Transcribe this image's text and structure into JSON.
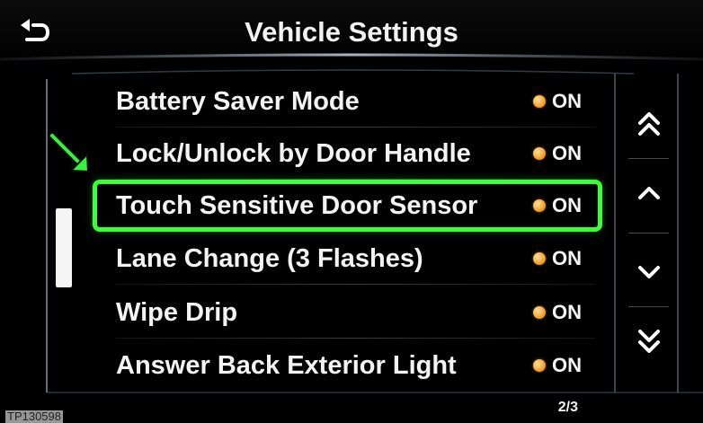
{
  "header": {
    "title": "Vehicle Settings",
    "back_icon": "back-icon"
  },
  "settings": [
    {
      "label": "Battery Saver Mode",
      "value": "ON",
      "status_color": "#f5a12b"
    },
    {
      "label": "Lock/Unlock by Door Handle",
      "value": "ON",
      "status_color": "#f5a12b"
    },
    {
      "label": "Touch Sensitive Door Sensor",
      "value": "ON",
      "status_color": "#f5a12b"
    },
    {
      "label": "Lane Change (3 Flashes)",
      "value": "ON",
      "status_color": "#f5a12b"
    },
    {
      "label": "Wipe Drip",
      "value": "ON",
      "status_color": "#f5a12b"
    },
    {
      "label": "Answer Back Exterior Light",
      "value": "ON",
      "status_color": "#f5a12b"
    }
  ],
  "navigation": {
    "page_up_icon": "double-chevron-up-icon",
    "line_up_icon": "chevron-up-icon",
    "line_down_icon": "chevron-down-icon",
    "page_down_icon": "double-chevron-down-icon"
  },
  "page_indicator": "2/3",
  "watermark": "TP130598",
  "colors": {
    "background": "#000000",
    "text": "#f3f3f3",
    "highlight": "#38ff38",
    "status_dot": "#f5a12b"
  }
}
